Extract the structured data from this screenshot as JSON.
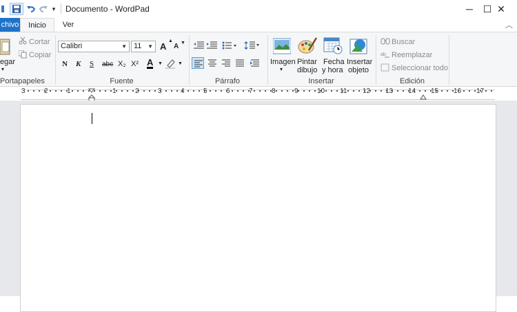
{
  "titlebar": {
    "title": "Documento - WordPad",
    "minimize": "─",
    "maximize": "☐",
    "close": "✕"
  },
  "tabs": {
    "archivo": "chivo",
    "inicio": "Inicio",
    "ver": "Ver"
  },
  "ribbon": {
    "portapapeles": {
      "label": "Portapapeles",
      "pegar": "egar",
      "cortar": "Cortar",
      "copiar": "Copiar"
    },
    "fuente": {
      "label": "Fuente",
      "font_name": "Calibri",
      "font_size": "11",
      "grow": "A",
      "shrink": "A",
      "bold": "N",
      "italic": "K",
      "underline": "S",
      "strike": "abc",
      "sub": "X₂",
      "sup": "X²",
      "color_a": "A"
    },
    "parrafo": {
      "label": "Párrafo"
    },
    "insertar": {
      "label": "Insertar",
      "imagen": "Imagen",
      "pintar_1": "Pintar",
      "pintar_2": "dibujo",
      "fecha_1": "Fecha",
      "fecha_2": "y hora",
      "objeto_1": "Insertar",
      "objeto_2": "objeto"
    },
    "edicion": {
      "label": "Edición",
      "buscar": "Buscar",
      "reemplazar": "Reemplazar",
      "seleccionar": "Seleccionar todo"
    }
  },
  "ruler": {
    "labels": [
      "3",
      "2",
      "1",
      "1",
      "2",
      "3",
      "4",
      "5",
      "6",
      "7",
      "8",
      "9",
      "10",
      "11",
      "12",
      "13",
      "14",
      "15",
      "16",
      "17"
    ]
  },
  "colors": {
    "accent": "#1e73c8",
    "ribbon_bg": "#f5f6f7",
    "doc_bg": "#e7e8ec"
  }
}
